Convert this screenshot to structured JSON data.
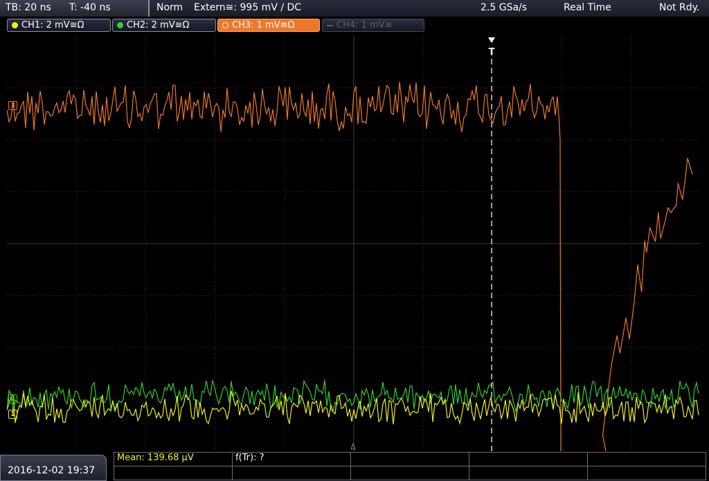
{
  "topbar": {
    "timebase": "TB: 20 ns",
    "trigger_offset": "T: -40 ns",
    "mode": "Norm",
    "trigger_source": "Extern≅: 995 mV ∕ DC",
    "sample_rate": "2.5 GSa/s",
    "acq_mode": "Real Time",
    "status": "Not Rdy."
  },
  "channels": [
    {
      "label": "CH1: 2 mV≅Ω",
      "color": "#f0f020",
      "active": true
    },
    {
      "label": "CH2: 2 mV≅Ω",
      "color": "#30d030",
      "active": true
    },
    {
      "label": "CH3: 1 mV≅Ω",
      "color": "#f07828",
      "active": true,
      "selected": true
    },
    {
      "label": "CH4: 1 mV≅",
      "color": "#5a5e6a",
      "active": false
    }
  ],
  "trigger_marker": "T",
  "waveform_markers": {
    "ch3": "3",
    "ch2": "2",
    "ch1": "1"
  },
  "footer": {
    "datetime": "2016-12-02 19:37",
    "mean": "Mean: 139.68 µV",
    "ftr": "f(Tr): ?"
  },
  "colors": {
    "ch1": "#f0f020",
    "ch2": "#30d030",
    "ch3": "#f07828",
    "grid": "#3a3c44"
  }
}
